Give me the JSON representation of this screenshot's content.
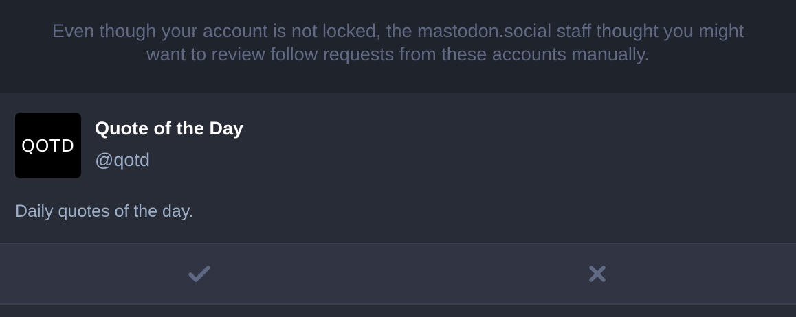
{
  "notice": {
    "text": "Even though your account is not locked, the mastodon.social staff thought you might want to review follow requests from these accounts manually."
  },
  "request": {
    "avatar_text": "QOTD",
    "display_name": "Quote of the Day",
    "acct": "@qotd",
    "bio": "Daily quotes of the day."
  },
  "actions": {
    "authorize_icon": "check-icon",
    "reject_icon": "times-icon"
  },
  "colors": {
    "background": "#1f232b",
    "card": "#282c37",
    "action_bar": "#313543",
    "muted_text": "#606984",
    "secondary_text": "#9baec8",
    "icon": "#606984"
  }
}
